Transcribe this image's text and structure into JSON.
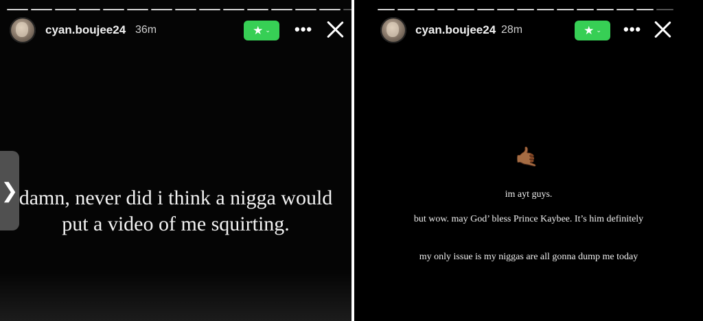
{
  "stories": [
    {
      "username": "cyan.boujee24",
      "time_ago": "36m",
      "text": "damn, never did i think a nigga would put a video of me squirting."
    },
    {
      "username": "cyan.boujee24",
      "time_ago": "28m",
      "emoji": "🤙🏾",
      "lines": [
        "im ayt guys.",
        "but wow. may God’ bless Prince Kaybee. It’s him definitely",
        "my only issue is my niggas are all gonna dump me today"
      ]
    }
  ],
  "controls": {
    "close_friends_icon": "star-icon",
    "chevron_icon": "chevron-down-icon",
    "more_icon": "more-icon",
    "close_icon": "close-icon",
    "next_icon": "chevron-right-icon",
    "star_glyph": "★",
    "chevron_glyph": "⌄",
    "more_glyph": "•••",
    "next_glyph": "❯"
  },
  "colors": {
    "close_friends_green": "#37cf55",
    "background": "#000000",
    "text": "#f3f3f3"
  }
}
